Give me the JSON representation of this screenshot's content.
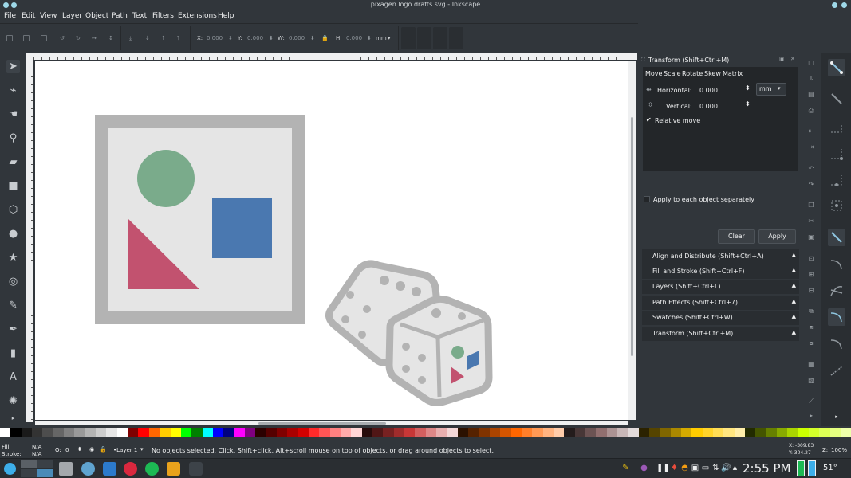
{
  "window": {
    "title": "pixagen logo drafts.svg - Inkscape"
  },
  "menu": [
    "File",
    "Edit",
    "View",
    "Layer",
    "Object",
    "Path",
    "Text",
    "Filters",
    "Extensions",
    "Help"
  ],
  "toolbar": {
    "x_label": "X:",
    "x_value": "0.000",
    "y_label": "Y:",
    "y_value": "0.000",
    "w_label": "W:",
    "w_value": "0.000",
    "h_label": "H:",
    "h_value": "0.000",
    "unit": "mm"
  },
  "transform": {
    "title": "Transform (Shift+Ctrl+M)",
    "tabs": [
      "Move",
      "Scale",
      "Rotate",
      "Skew",
      "Matrix"
    ],
    "horizontal_label": "Horizontal:",
    "horizontal_value": "0.000",
    "vertical_label": "Vertical:",
    "vertical_value": "0.000",
    "unit": "mm",
    "relative_move": "Relative move",
    "apply_each": "Apply to each object separately",
    "clear": "Clear",
    "apply": "Apply"
  },
  "docks": [
    "Align and Distribute (Shift+Ctrl+A)",
    "Fill and Stroke (Shift+Ctrl+F)",
    "Layers (Shift+Ctrl+L)",
    "Path Effects  (Shift+Ctrl+7)",
    "Swatches (Shift+Ctrl+W)",
    "Transform (Shift+Ctrl+M)"
  ],
  "status": {
    "fill_label": "Fill:",
    "fill_value": "N/A",
    "stroke_label": "Stroke:",
    "stroke_value": "N/A",
    "opacity_label": "O:",
    "opacity_value": "0",
    "layer": "•Layer 1",
    "message": "No objects selected. Click, Shift+click, Alt+scroll mouse on top of objects, or drag around objects to select.",
    "x": "X: -309.83",
    "y": "Y:  304.27",
    "z_label": "Z:",
    "zoom": "100%"
  },
  "taskbar": {
    "time": "2:55 PM",
    "temperature": "51°"
  },
  "colors": {
    "accent": "#3daee9",
    "frame_gray": "#b3b3b3",
    "inner_gray": "#e5e5e5",
    "green": "#7aab8b",
    "blue": "#4a78b0",
    "pink": "#c2526f"
  }
}
